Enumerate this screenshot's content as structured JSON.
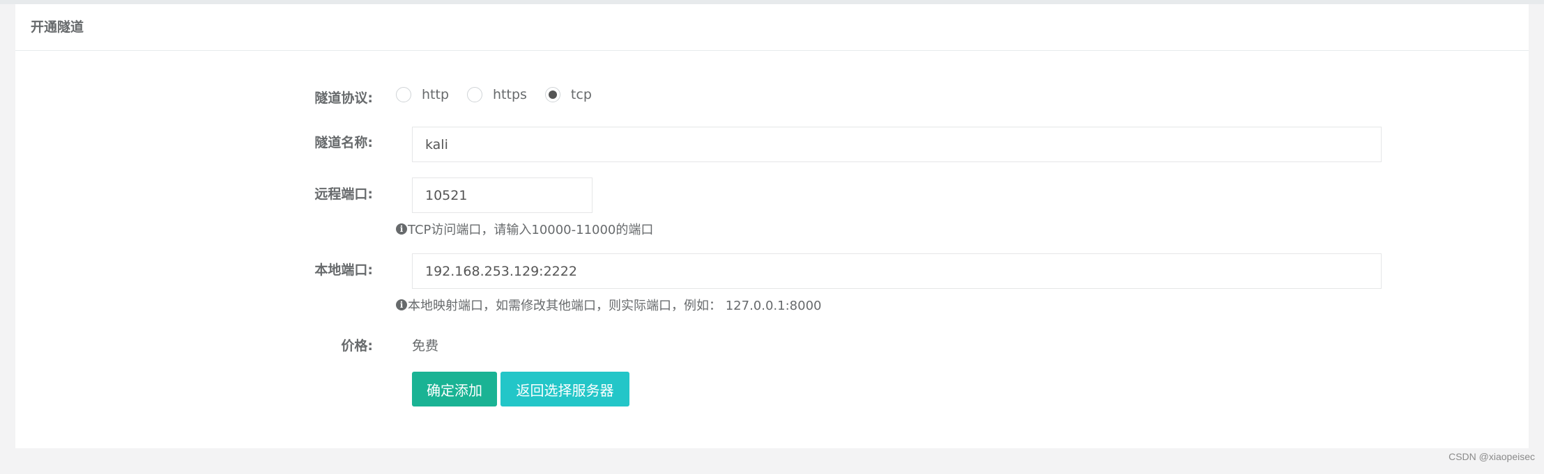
{
  "panel": {
    "title": "开通隧道"
  },
  "form": {
    "protocol": {
      "label": "隧道协议:",
      "options": [
        "http",
        "https",
        "tcp"
      ],
      "selected": "tcp"
    },
    "name": {
      "label": "隧道名称:",
      "value": "kali"
    },
    "remote_port": {
      "label": "远程端口:",
      "value": "10521",
      "help": "TCP访问端口，请输入10000-11000的端口"
    },
    "local_port": {
      "label": "本地端口:",
      "value": "192.168.253.129:2222",
      "help": "本地映射端口，如需修改其他端口，则实际端口，例如： 127.0.0.1:8000"
    },
    "price": {
      "label": "价格:",
      "value": "免费"
    }
  },
  "buttons": {
    "confirm": "确定添加",
    "back": "返回选择服务器"
  },
  "watermark": "CSDN @xiaopeisec",
  "icons": {
    "help": "info-circle-icon"
  },
  "colors": {
    "primary": "#1ab394",
    "info": "#23c6c8",
    "text": "#676a6c"
  }
}
